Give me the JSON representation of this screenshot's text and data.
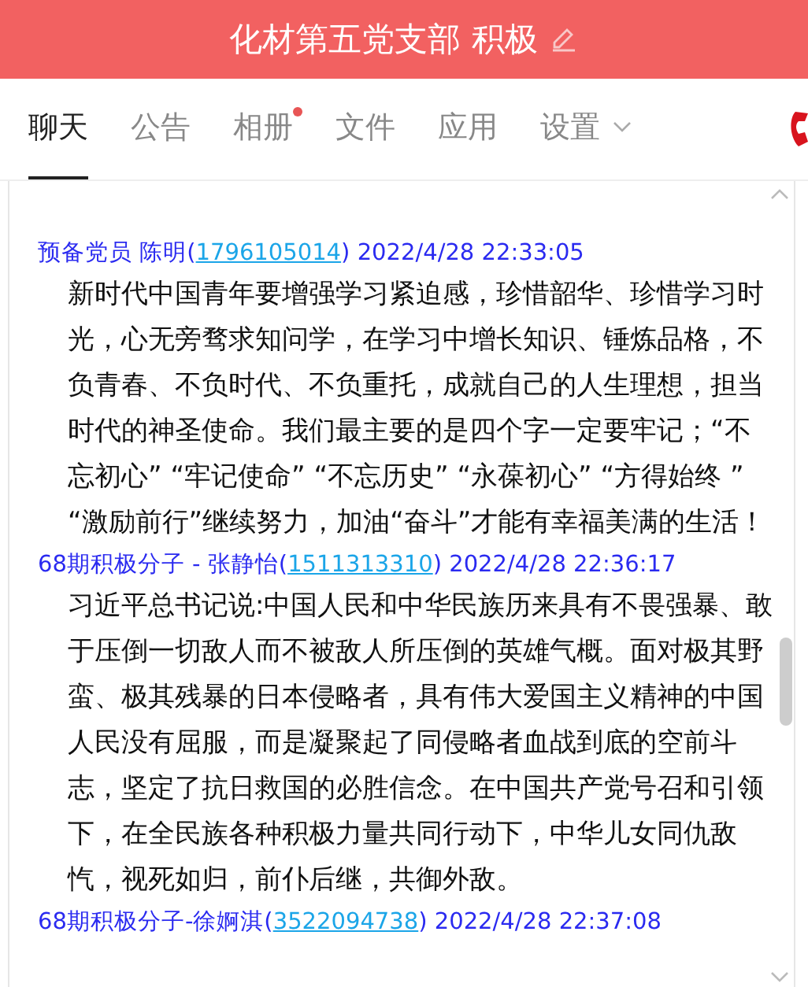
{
  "window": {
    "title": "化材第五党支部 积极"
  },
  "tabs": [
    {
      "label": "聊天",
      "selected": true,
      "dot": false,
      "dropdown": false
    },
    {
      "label": "公告",
      "selected": false,
      "dot": false,
      "dropdown": false
    },
    {
      "label": "相册",
      "selected": false,
      "dot": true,
      "dropdown": false
    },
    {
      "label": "文件",
      "selected": false,
      "dot": false,
      "dropdown": false
    },
    {
      "label": "应用",
      "selected": false,
      "dot": false,
      "dropdown": false
    },
    {
      "label": "设置",
      "selected": false,
      "dot": false,
      "dropdown": true
    }
  ],
  "messages": [
    {
      "before_link": "预备党员 陈明(",
      "link": "1796105014",
      "after_link": ") 2022/4/28 22:33:05",
      "text": "新时代中国青年要增强学习紧迫感，珍惜韶华、珍惜学习时光，心无旁骛求知问学，在学习中增长知识、锤炼品格，不负青春、不负时代、不负重托，成就自己的人生理想，担当时代的神圣使命。我们最主要的是四个字一定要牢记；“不忘初心”  “牢记使命”  “不忘历史”  “永葆初心”  “方得始终 ” “激励前行”继续努力，加油“奋斗”才能有幸福美满的生活！"
    },
    {
      "before_link": "68期积极分子 - 张静怡(",
      "link": "1511313310",
      "after_link": ") 2022/4/28 22:36:17",
      "text": "习近平总书记说:中国人民和中华民族历来具有不畏强暴、敢于压倒一切敌人而不被敌人所压倒的英雄气概。面对极其野蛮、极其残暴的日本侵略者，具有伟大爱国主义精神的中国人民没有屈服，而是凝聚起了同侵略者血战到底的空前斗志，坚定了抗日救国的必胜信念。在中国共产党号召和引领下，在全民族各种积极力量共同行动下，中华儿女同仇敌忾，视死如归，前仆后继，共御外敌。"
    },
    {
      "before_link": "68期积极分子-徐婀淇(",
      "link": "3522094738",
      "after_link": ") 2022/4/28 22:37:08"
    }
  ]
}
